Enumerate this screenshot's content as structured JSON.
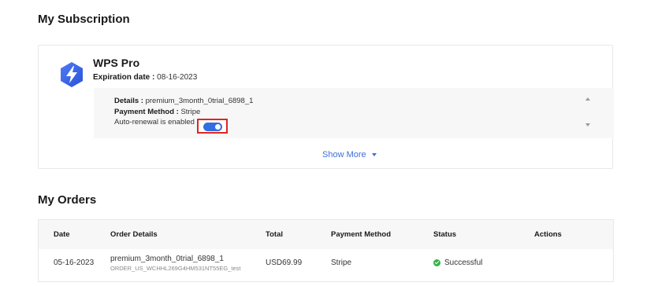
{
  "subscription": {
    "heading": "My Subscription",
    "product_name": "WPS Pro",
    "expiration_label": "Expiration date :",
    "expiration_value": "08-16-2023",
    "details_label": "Details :",
    "details_value": "premium_3month_0trial_6898_1",
    "payment_method_label": "Payment Method :",
    "payment_method_value": "Stripe",
    "auto_renewal_text": "Auto-renewal is enabled",
    "auto_renewal_on": true,
    "show_more": "Show More",
    "colors": {
      "accent": "#2f6fe0",
      "highlight_border": "#e02424",
      "link": "#3d6fd6"
    },
    "icons": {
      "logo": "wps-lightning-hexagon-icon",
      "scroll_up": "scroll-up-arrow-icon",
      "scroll_down": "scroll-down-arrow-icon",
      "caret": "caret-down-icon"
    }
  },
  "orders": {
    "heading": "My Orders",
    "columns": [
      "Date",
      "Order Details",
      "Total",
      "Payment Method",
      "Status",
      "Actions"
    ],
    "rows": [
      {
        "date": "05-16-2023",
        "order_title": "premium_3month_0trial_6898_1",
        "order_id": "ORDER_US_WCHHL269G4HM531NT55EG_test",
        "total": "USD69.99",
        "payment_method": "Stripe",
        "status": "Successful",
        "status_icon": "check-circle-icon",
        "actions": ""
      }
    ],
    "colors": {
      "success": "#2fb344"
    }
  }
}
